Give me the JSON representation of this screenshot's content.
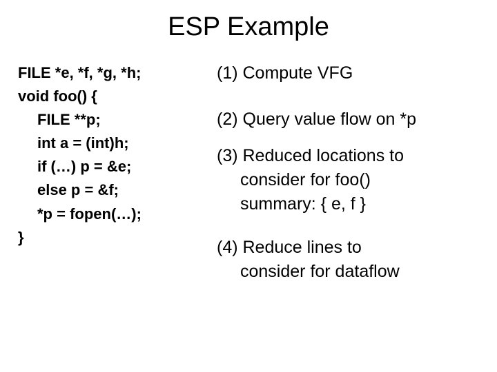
{
  "title": "ESP Example",
  "code": {
    "line1": "FILE *e, *f, *g, *h;",
    "line2": "void foo() {",
    "line3": "FILE **p;",
    "line4": "int a = (int)h;",
    "line5": "if (…) p = &e;",
    "line6": "else p = &f;",
    "line7": "*p = fopen(…);",
    "line8": "}"
  },
  "steps": {
    "s1": "(1) Compute VFG",
    "s2": "(2) Query value flow on *p",
    "s3a": "(3) Reduced locations to",
    "s3b": "consider for foo()",
    "s3c": "summary: { e, f }",
    "s4a": "(4) Reduce lines to",
    "s4b": "consider for dataflow"
  }
}
